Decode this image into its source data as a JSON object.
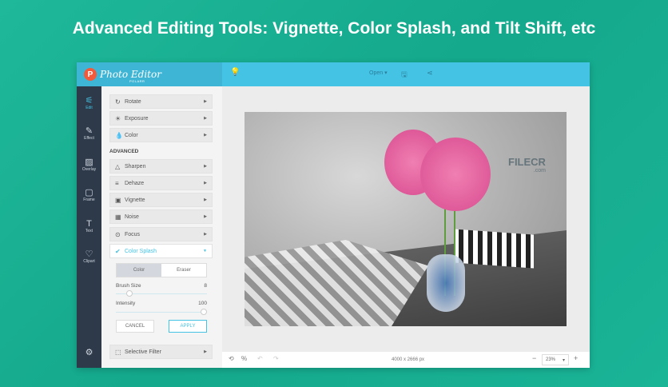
{
  "headline": "Advanced Editing Tools: Vignette, Color Splash, and Tilt Shift, etc",
  "app": {
    "logo_text": "Photo Editor",
    "logo_sub": "POLARR",
    "logo_letter": "P"
  },
  "topbar": {
    "open_label": "Open ▾",
    "bulb_icon": "💡",
    "save_icon": "🖫",
    "share_icon": "⋖"
  },
  "rail": [
    {
      "label": "Edit",
      "icon": "⚟"
    },
    {
      "label": "Effect",
      "icon": "✎"
    },
    {
      "label": "Overlay",
      "icon": "▨"
    },
    {
      "label": "Frame",
      "icon": "▢"
    },
    {
      "label": "Text",
      "icon": "T"
    },
    {
      "label": "Clipart",
      "icon": "♡"
    }
  ],
  "settings_icon": "⚙",
  "panel": {
    "basic": [
      {
        "label": "Rotate",
        "icon": "↻"
      },
      {
        "label": "Exposure",
        "icon": "☀"
      },
      {
        "label": "Color",
        "icon": "💧"
      }
    ],
    "section": "ADVANCED",
    "advanced": [
      {
        "label": "Sharpen",
        "icon": "△"
      },
      {
        "label": "Dehaze",
        "icon": "≡"
      },
      {
        "label": "Vignette",
        "icon": "▣"
      },
      {
        "label": "Noise",
        "icon": "▦"
      },
      {
        "label": "Focus",
        "icon": "⊙"
      }
    ],
    "color_splash": {
      "label": "Color Splash",
      "icon": "✔",
      "mode_color": "Color",
      "mode_eraser": "Eraser",
      "brush_label": "Brush Size",
      "brush_value": "8",
      "intensity_label": "Intensity",
      "intensity_value": "100",
      "brush_fraction": 0.12,
      "intensity_fraction": 1.0,
      "cancel": "CANCEL",
      "apply": "APPLY"
    },
    "selective": {
      "label": "Selective Filter",
      "icon": "⬚"
    }
  },
  "watermark": {
    "text": "FILECR",
    "sub": ".com"
  },
  "bottom": {
    "dimensions": "4000 x 2666 px",
    "zoom": "23%",
    "fit_icon": "⟲",
    "percent_icon": "%",
    "undo_icon": "↶",
    "redo_icon": "↷",
    "minus": "−",
    "plus": "+",
    "caret": "▾"
  },
  "colors": {
    "accent": "#45c3e4",
    "rail": "#2e3a4a",
    "background": "#1fb89a"
  }
}
